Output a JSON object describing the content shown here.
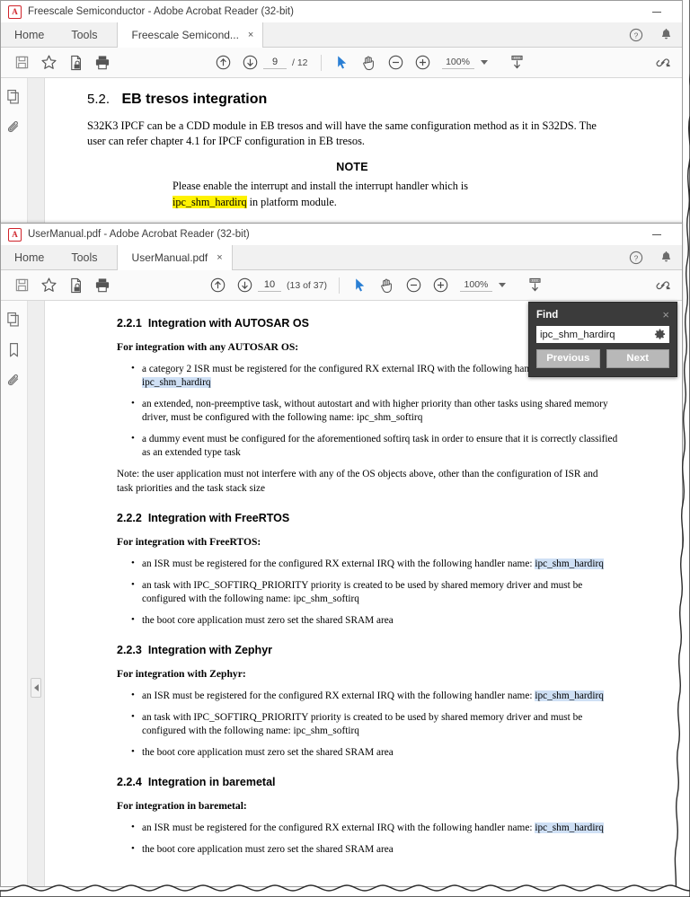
{
  "window_back": {
    "titlebar": {
      "app_icon": "acrobat-pdf-icon",
      "title": "Freescale Semiconductor - Adobe Acrobat Reader (32-bit)",
      "minimize_label": "Minimize"
    },
    "menu": {
      "home": "Home",
      "tools": "Tools"
    },
    "tab": {
      "label": "Freescale Semicond...",
      "close": "×"
    },
    "tab_right": {
      "help_icon": "help-circle-icon",
      "bell_icon": "notification-bell-icon"
    },
    "toolbar": {
      "save_icon": "save-floppy-icon",
      "star_icon": "add-to-favorites-star-icon",
      "secure_icon": "protect-document-icon",
      "print_icon": "print-icon",
      "prev_page_icon": "previous-page-arrow-icon",
      "next_page_icon": "next-page-arrow-icon",
      "page_value": "9",
      "page_total": "/ 12",
      "select_icon": "select-cursor-icon",
      "hand_icon": "hand-pan-icon",
      "zoom_out_icon": "zoom-out-icon",
      "zoom_in_icon": "zoom-in-icon",
      "zoom_value": "100%",
      "fit_icon": "fit-page-icon",
      "share_icon": "share-link-icon"
    },
    "navrail": {
      "thumbnails_icon": "page-thumbnails-icon",
      "attachments_icon": "attachments-paperclip-icon"
    },
    "document": {
      "heading_num": "5.2.",
      "heading_text": "EB tresos integration",
      "paragraph": "S32K3 IPCF can be a CDD module in EB tresos and will have the same configuration method as it in S32DS. The user can refer chapter 4.1 for IPCF configuration in EB tresos.",
      "note_title": "NOTE",
      "note_line1": "Please enable the interrupt and install the interrupt handler which is",
      "note_highlight": "ipc_shm_hardirq",
      "note_line2_rest": " in platform module."
    }
  },
  "window_front": {
    "titlebar": {
      "app_icon": "acrobat-pdf-icon",
      "title": "UserManual.pdf - Adobe Acrobat Reader (32-bit)",
      "minimize_label": "Minimize"
    },
    "menu": {
      "home": "Home",
      "tools": "Tools"
    },
    "tab": {
      "label": "UserManual.pdf",
      "close": "×"
    },
    "tab_right": {
      "help_icon": "help-circle-icon",
      "bell_icon": "notification-bell-icon"
    },
    "toolbar": {
      "save_icon": "save-floppy-icon",
      "star_icon": "add-to-favorites-star-icon",
      "secure_icon": "protect-document-icon",
      "print_icon": "print-icon",
      "prev_page_icon": "previous-page-arrow-icon",
      "next_page_icon": "next-page-arrow-icon",
      "page_value": "10",
      "page_total": "(13 of 37)",
      "select_icon": "select-cursor-icon",
      "hand_icon": "hand-pan-icon",
      "zoom_out_icon": "zoom-out-icon",
      "zoom_in_icon": "zoom-in-icon",
      "zoom_value": "100%",
      "fit_icon": "fit-page-icon",
      "share_icon": "share-link-icon"
    },
    "navrail": {
      "thumbnails_icon": "page-thumbnails-icon",
      "bookmarks_icon": "bookmarks-ribbon-icon",
      "attachments_icon": "attachments-paperclip-icon"
    },
    "find": {
      "title": "Find",
      "close": "×",
      "query": "ipc_shm_hardirq",
      "settings_icon": "find-settings-gear-icon",
      "previous_label": "Previous",
      "next_label": "Next"
    },
    "document": {
      "sections": [
        {
          "num": "2.2.1",
          "title": "Integration with AUTOSAR OS",
          "lead": "For integration with any AUTOSAR OS:",
          "bullets": [
            {
              "pre": "a category 2 ISR must be registered for the configured RX external IRQ with the following handler name: ",
              "sel": "ipc_shm_hardirq",
              "post": ""
            },
            {
              "pre": "an extended, non-preemptive task, without autostart and with higher priority than other tasks using shared memory driver, must be configured with the following name: ipc_shm_softirq",
              "sel": "",
              "post": ""
            },
            {
              "pre": "a dummy event must be configured for the aforementioned softirq task in order to ensure that it is correctly classified as an extended type task",
              "sel": "",
              "post": ""
            }
          ],
          "note": "Note: the user application must not interfere with any of the OS objects above, other than the configuration of ISR and task priorities and the task stack size"
        },
        {
          "num": "2.2.2",
          "title": "Integration with FreeRTOS",
          "lead": "For integration with FreeRTOS:",
          "bullets": [
            {
              "pre": "an ISR must be registered for the configured RX external IRQ with the following handler name: ",
              "sel": "ipc_shm_hardirq",
              "post": ""
            },
            {
              "pre": "an task with IPC_SOFTIRQ_PRIORITY priority is created to be used by shared memory driver and must be configured with the following name: ipc_shm_softirq",
              "sel": "",
              "post": ""
            },
            {
              "pre": "the boot core application must zero set the shared SRAM area",
              "sel": "",
              "post": ""
            }
          ],
          "note": ""
        },
        {
          "num": "2.2.3",
          "title": "Integration with Zephyr",
          "lead": "For integration with Zephyr:",
          "bullets": [
            {
              "pre": "an ISR must be registered for the configured RX external IRQ with the following handler name: ",
              "sel": "ipc_shm_hardirq",
              "post": ""
            },
            {
              "pre": "an task with IPC_SOFTIRQ_PRIORITY priority is created to be used by shared memory driver and must be configured with the following name: ipc_shm_softirq",
              "sel": "",
              "post": ""
            },
            {
              "pre": "the boot core application must zero set the shared SRAM area",
              "sel": "",
              "post": ""
            }
          ],
          "note": ""
        },
        {
          "num": "2.2.4",
          "title": "Integration in baremetal",
          "lead": "For integration in baremetal:",
          "bullets": [
            {
              "pre": "an ISR must be registered for the configured RX external IRQ with the following handler name: ",
              "sel": "ipc_shm_hardirq",
              "post": ""
            },
            {
              "pre": "the boot core application must zero set the shared SRAM area",
              "sel": "",
              "post": ""
            }
          ],
          "note": ""
        }
      ]
    }
  },
  "colors": {
    "accent_blue": "#2a7fd4",
    "selection_blue": "#cfe0f5",
    "highlight_yellow": "#fff200",
    "find_panel_bg": "#3b3b3b",
    "acrobat_red": "#d0242b",
    "toolbar_bg": "#fafafa",
    "tabstrip_bg": "#f1f1f1"
  }
}
